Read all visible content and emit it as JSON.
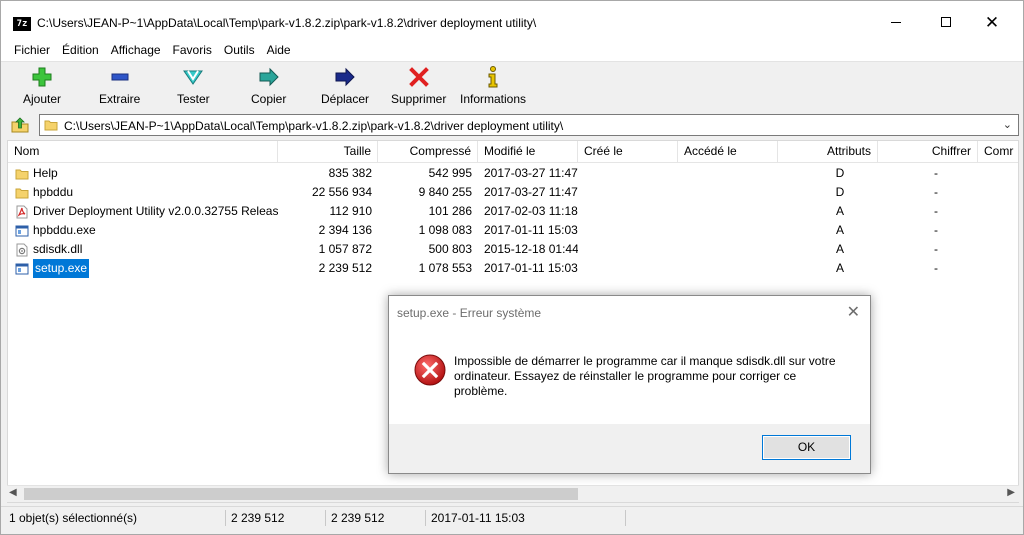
{
  "window": {
    "title": "C:\\Users\\JEAN-P~1\\AppData\\Local\\Temp\\park-v1.8.2.zip\\park-v1.8.2\\driver deployment utility\\",
    "app_icon_text": "7z"
  },
  "menu": {
    "items": [
      "Fichier",
      "Édition",
      "Affichage",
      "Favoris",
      "Outils",
      "Aide"
    ]
  },
  "toolbar": {
    "add": "Ajouter",
    "extract": "Extraire",
    "test": "Tester",
    "copy": "Copier",
    "move": "Déplacer",
    "delete": "Supprimer",
    "info": "Informations"
  },
  "address": {
    "path": "C:\\Users\\JEAN-P~1\\AppData\\Local\\Temp\\park-v1.8.2.zip\\park-v1.8.2\\driver deployment utility\\"
  },
  "columns": [
    "Nom",
    "Taille",
    "Compressé",
    "Modifié le",
    "Créé le",
    "Accédé le",
    "Attributs",
    "Chiffrer",
    "Comr"
  ],
  "files": [
    {
      "name": "Help",
      "icon": "folder-icon",
      "size": "835 382",
      "packed": "542 995",
      "modified": "2017-03-27 11:47",
      "attr": "D",
      "encrypted": "-"
    },
    {
      "name": "hpbddu",
      "icon": "folder-icon",
      "size": "22 556 934",
      "packed": "9 840 255",
      "modified": "2017-03-27 11:47",
      "attr": "D",
      "encrypted": "-"
    },
    {
      "name": "Driver Deployment Utility v2.0.0.32755 Releas...",
      "icon": "pdf-icon",
      "size": "112 910",
      "packed": "101 286",
      "modified": "2017-02-03 11:18",
      "attr": "A",
      "encrypted": "-"
    },
    {
      "name": "hpbddu.exe",
      "icon": "exe-icon",
      "size": "2 394 136",
      "packed": "1 098 083",
      "modified": "2017-01-11 15:03",
      "attr": "A",
      "encrypted": "-"
    },
    {
      "name": "sdisdk.dll",
      "icon": "dll-icon",
      "size": "1 057 872",
      "packed": "500 803",
      "modified": "2015-12-18 01:44",
      "attr": "A",
      "encrypted": "-"
    },
    {
      "name": "setup.exe",
      "icon": "exe-icon",
      "size": "2 239 512",
      "packed": "1 078 553",
      "modified": "2017-01-11 15:03",
      "attr": "A",
      "encrypted": "-"
    }
  ],
  "status": {
    "selection": "1 objet(s) sélectionné(s)",
    "size": "2 239 512",
    "packed": "2 239 512",
    "modified": "2017-01-11 15:03"
  },
  "dialog": {
    "title": "setup.exe - Erreur système",
    "line1": "Impossible de démarrer le programme car il manque sdisdk.dll sur votre",
    "line2": "ordinateur. Essayez de réinstaller le programme pour corriger ce",
    "line3": "problème.",
    "ok_label": "OK"
  },
  "colors": {
    "selection": "#0078d7",
    "folder": "#f5d26b",
    "error_red": "#d42a2a"
  }
}
